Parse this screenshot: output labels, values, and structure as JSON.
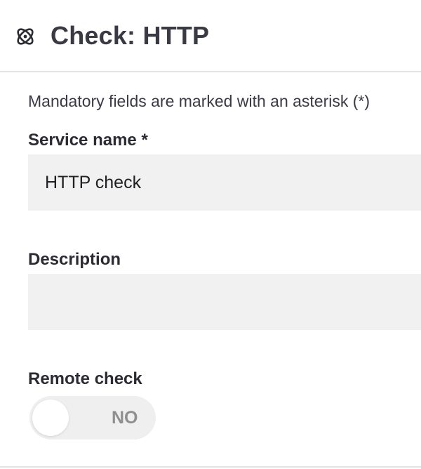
{
  "header": {
    "icon": "atom-icon",
    "title": "Check: HTTP"
  },
  "form": {
    "hint": "Mandatory fields are marked with an asterisk (*)",
    "service_name": {
      "label": "Service name *",
      "value": "HTTP check"
    },
    "description": {
      "label": "Description",
      "value": ""
    },
    "remote_check": {
      "label": "Remote check",
      "state": "NO"
    }
  }
}
